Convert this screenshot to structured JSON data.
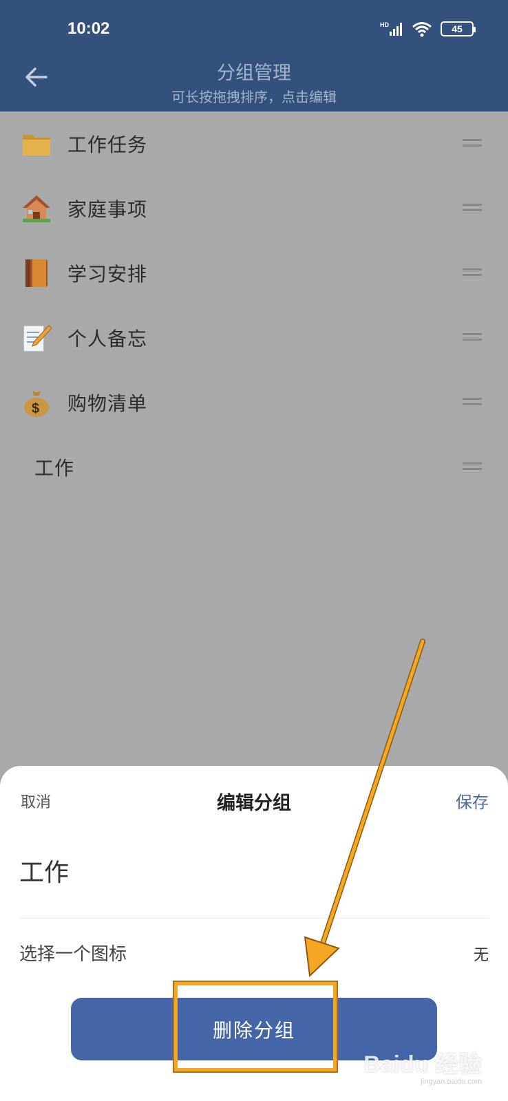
{
  "status_bar": {
    "time": "10:02",
    "battery": "45",
    "network": "HD"
  },
  "header": {
    "title": "分组管理",
    "subtitle": "可长按拖拽排序，点击编辑"
  },
  "groups": [
    {
      "label": "工作任务",
      "icon": "folder-icon"
    },
    {
      "label": "家庭事项",
      "icon": "house-icon"
    },
    {
      "label": "学习安排",
      "icon": "book-icon"
    },
    {
      "label": "个人备忘",
      "icon": "memo-icon"
    },
    {
      "label": "购物清单",
      "icon": "money-bag-icon"
    },
    {
      "label": "工作",
      "icon": ""
    }
  ],
  "sheet": {
    "cancel_label": "取消",
    "title": "编辑分组",
    "save_label": "保存",
    "name_value": "工作",
    "icon_label": "选择一个图标",
    "icon_value": "无",
    "delete_label": "删除分组"
  },
  "watermark": {
    "main": "Baidu 经验",
    "sub": "jingyan.baidu.com"
  },
  "colors": {
    "header": "#34517e",
    "accent": "#4466a8",
    "highlight": "#f5a623",
    "overlay": "#a9a9a9"
  }
}
